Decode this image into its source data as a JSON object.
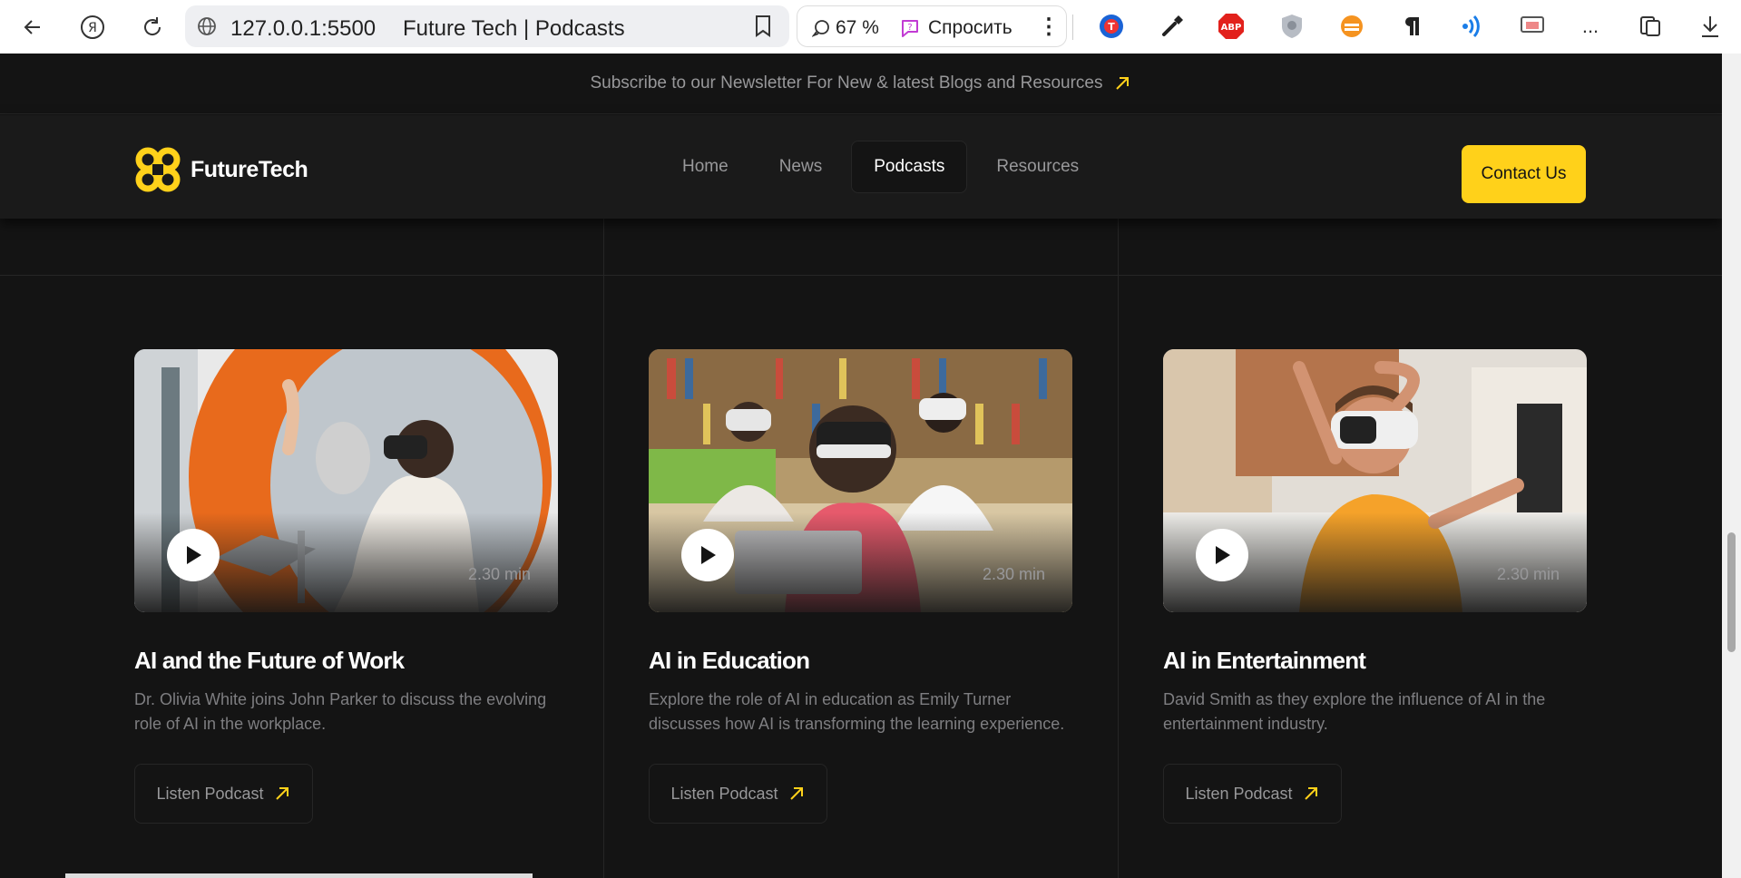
{
  "browser": {
    "url": "127.0.0.1:5500",
    "tab_title": "Future Tech | Podcasts",
    "zoom": "67 %",
    "ask_label": "Спросить",
    "more_label": "..."
  },
  "newsletter": {
    "text": "Subscribe to our Newsletter For New & latest Blogs and Resources"
  },
  "brand": {
    "name": "FutureTech",
    "accent": "#ffd11a"
  },
  "nav": {
    "links": [
      "Home",
      "News",
      "Podcasts",
      "Resources"
    ],
    "active": "Podcasts",
    "contact": "Contact Us"
  },
  "podcasts": [
    {
      "title": "AI and the Future of Work",
      "description": "Dr. Olivia White joins John Parker to discuss the evolving role of AI in the workplace.",
      "duration": "2.30 min",
      "cta": "Listen Podcast"
    },
    {
      "title": "AI in Education",
      "description": "Explore the role of AI in education as Emily Turner discusses how AI is transforming the learning experience.",
      "duration": "2.30 min",
      "cta": "Listen Podcast"
    },
    {
      "title": "AI in Entertainment",
      "description": "David Smith as they explore the influence of AI in the entertainment industry.",
      "duration": "2.30 min",
      "cta": "Listen Podcast"
    }
  ]
}
